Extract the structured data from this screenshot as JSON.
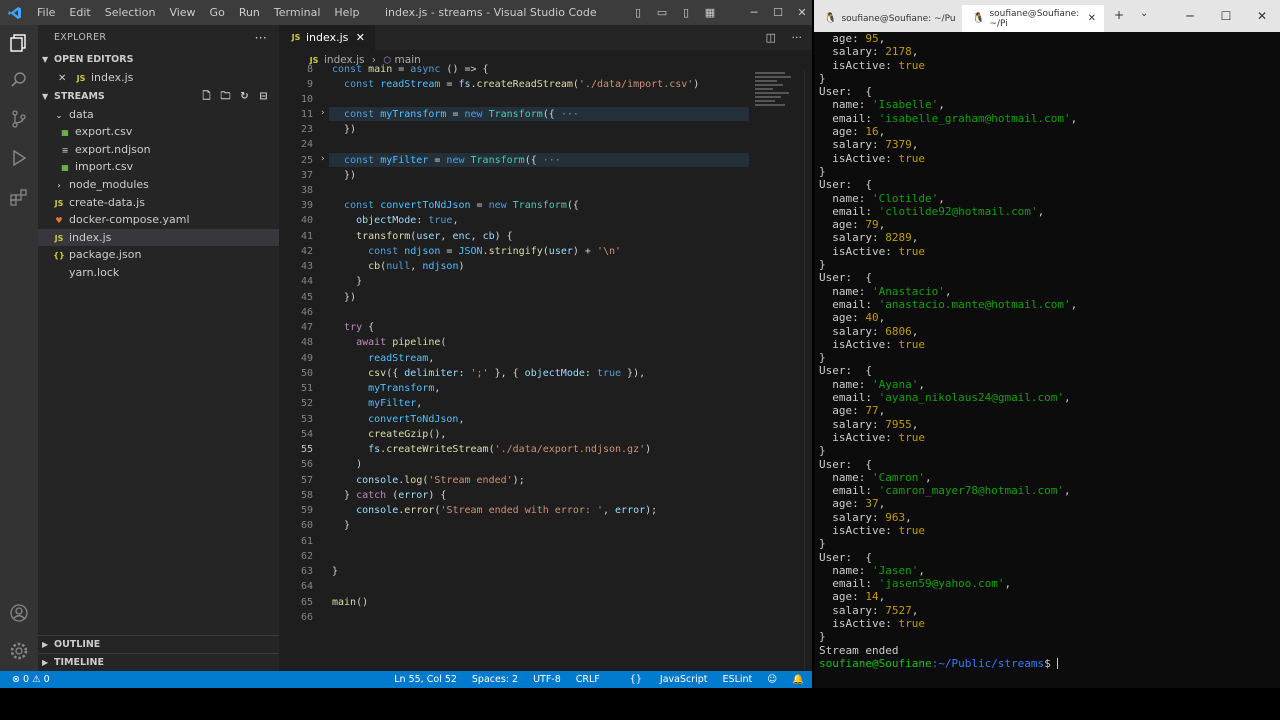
{
  "vscode": {
    "menu": [
      "File",
      "Edit",
      "Selection",
      "View",
      "Go",
      "Run",
      "Terminal",
      "Help"
    ],
    "window_title": "index.js - streams - Visual Studio Code",
    "sidebar": {
      "title": "EXPLORER",
      "open_editors_label": "OPEN EDITORS",
      "open_editor_file": "index.js",
      "project_label": "STREAMS",
      "tree": [
        {
          "name": "data",
          "type": "folder",
          "level": 1
        },
        {
          "name": "export.csv",
          "type": "csv",
          "level": 2
        },
        {
          "name": "export.ndjson",
          "type": "ndjson",
          "level": 2
        },
        {
          "name": "import.csv",
          "type": "csv",
          "level": 2
        },
        {
          "name": "node_modules",
          "type": "folder",
          "level": 1
        },
        {
          "name": "create-data.js",
          "type": "js",
          "level": 1
        },
        {
          "name": "docker-compose.yaml",
          "type": "yaml",
          "level": 1
        },
        {
          "name": "index.js",
          "type": "js",
          "level": 1
        },
        {
          "name": "package.json",
          "type": "json",
          "level": 1
        },
        {
          "name": "yarn.lock",
          "type": "lock",
          "level": 1
        }
      ],
      "outline_label": "OUTLINE",
      "timeline_label": "TIMELINE"
    },
    "editor": {
      "tab_label": "index.js",
      "breadcrumb_file": "index.js",
      "breadcrumb_symbol": "main",
      "line_numbers": [
        "8",
        "9",
        "10",
        "11",
        "23",
        "24",
        "25",
        "37",
        "38",
        "39",
        "40",
        "41",
        "42",
        "43",
        "44",
        "45",
        "46",
        "47",
        "48",
        "49",
        "50",
        "51",
        "52",
        "53",
        "54",
        "55",
        "56",
        "57",
        "58",
        "59",
        "60",
        "61",
        "62",
        "63",
        "64",
        "65",
        "66"
      ],
      "current_line": "55"
    },
    "status": {
      "errors": "0",
      "warnings": "0",
      "position": "Ln 55, Col 52",
      "spaces": "Spaces: 2",
      "encoding": "UTF-8",
      "eol": "CRLF",
      "language": "JavaScript",
      "linter": "ESLint"
    }
  },
  "terminal": {
    "tab1_title": "soufiane@Soufiane: ~/Pu",
    "tab2_title": "soufiane@Soufiane: ~/Pi",
    "top_partial": {
      "age": "95",
      "salary": "2178",
      "isActive": "true"
    },
    "users": [
      {
        "name": "Isabelle",
        "email": "isabelle_graham@hotmail.com",
        "age": "16",
        "salary": "7379",
        "isActive": "true"
      },
      {
        "name": "Clotilde",
        "email": "clotilde92@hotmail.com",
        "age": "79",
        "salary": "8289",
        "isActive": "true"
      },
      {
        "name": "Anastacio",
        "email": "anastacio.mante@hotmail.com",
        "age": "40",
        "salary": "6806",
        "isActive": "true"
      },
      {
        "name": "Ayana",
        "email": "ayana_nikolaus24@gmail.com",
        "age": "77",
        "salary": "7955",
        "isActive": "true"
      },
      {
        "name": "Camron",
        "email": "camron_mayer78@hotmail.com",
        "age": "37",
        "salary": "963",
        "isActive": "true"
      },
      {
        "name": "Jasen",
        "email": "jasen59@yahoo.com",
        "age": "14",
        "salary": "7527",
        "isActive": "true"
      }
    ],
    "end_message": "Stream ended",
    "prompt_user": "soufiane@Soufiane",
    "prompt_path": ":~/Public/streams"
  }
}
